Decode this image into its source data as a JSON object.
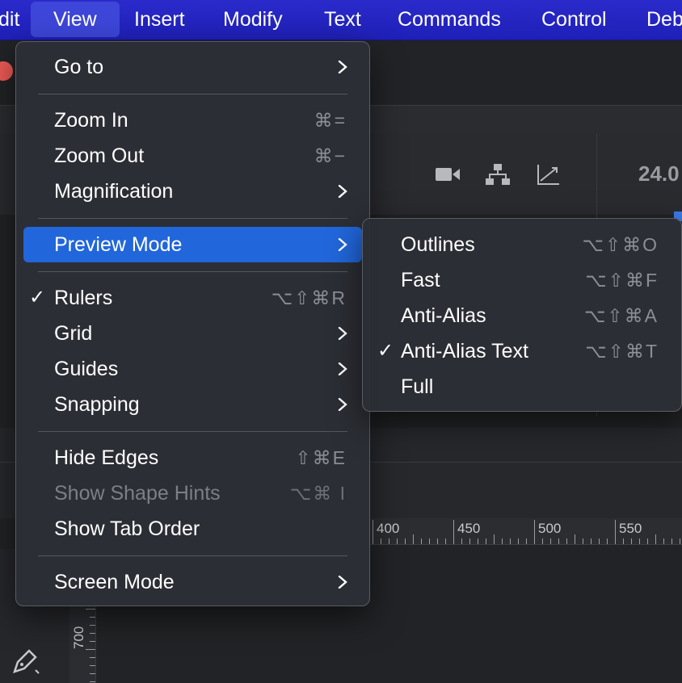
{
  "menubar": {
    "items": [
      "dit",
      "View",
      "Insert",
      "Modify",
      "Text",
      "Commands",
      "Control",
      "Deb"
    ],
    "active": "View"
  },
  "view_menu": {
    "items": [
      {
        "label": "Go to",
        "submenu": true
      },
      {
        "label": "Zoom In",
        "shortcut": "⌘="
      },
      {
        "label": "Zoom Out",
        "shortcut": "⌘−"
      },
      {
        "label": "Magnification",
        "submenu": true
      },
      {
        "label": "Preview Mode",
        "submenu": true,
        "highlighted": true
      },
      {
        "label": "Rulers",
        "shortcut": "⌥⇧⌘R",
        "checked": true
      },
      {
        "label": "Grid",
        "submenu": true
      },
      {
        "label": "Guides",
        "submenu": true
      },
      {
        "label": "Snapping",
        "submenu": true
      },
      {
        "label": "Hide Edges",
        "shortcut": "⇧⌘E"
      },
      {
        "label": "Show Shape Hints",
        "shortcut": "⌥⌘ I",
        "disabled": true
      },
      {
        "label": "Show Tab Order"
      },
      {
        "label": "Screen Mode",
        "submenu": true
      }
    ],
    "check_mark": "✓"
  },
  "preview_submenu": {
    "items": [
      {
        "label": "Outlines",
        "shortcut": "⌥⇧⌘O"
      },
      {
        "label": "Fast",
        "shortcut": "⌥⇧⌘F"
      },
      {
        "label": "Anti-Alias",
        "shortcut": "⌥⇧⌘A"
      },
      {
        "label": "Anti-Alias Text",
        "shortcut": "⌥⇧⌘T",
        "checked": true
      },
      {
        "label": "Full"
      }
    ]
  },
  "background": {
    "fps_partial": "24.0",
    "ruler_h_labels": [
      "400",
      "450",
      "500",
      "550"
    ],
    "ruler_v_label": "700",
    "icons": [
      "camera-icon",
      "hierarchy-icon",
      "graph-icon",
      "pen-tool-icon"
    ]
  },
  "colors": {
    "menubar": "#2323c4",
    "menu_highlight": "#2166db",
    "menu_background": "#2c2e36",
    "traffic_red": "#ee5b56"
  }
}
